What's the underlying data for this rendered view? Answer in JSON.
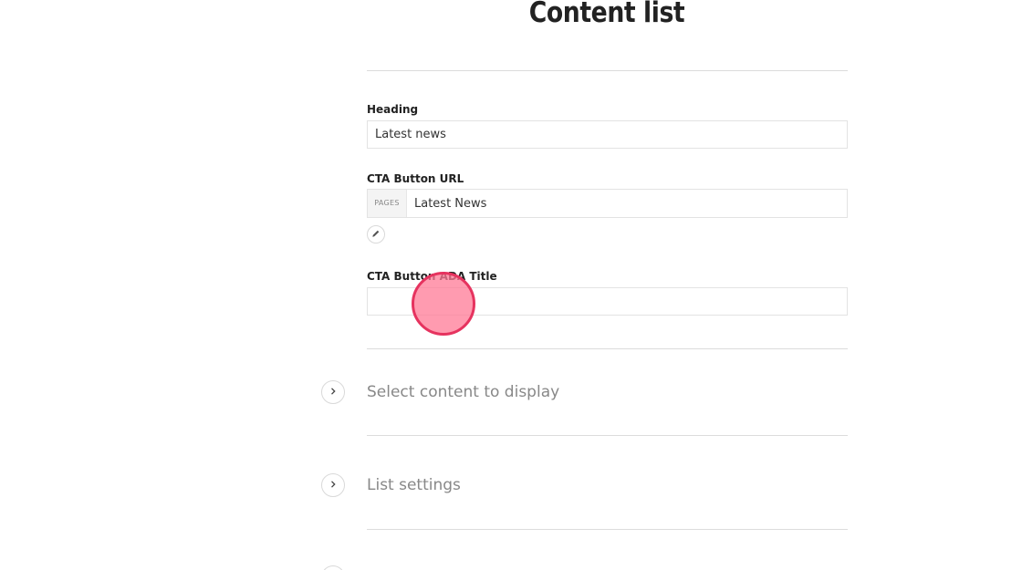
{
  "page_title": "Content list",
  "form": {
    "heading": {
      "label": "Heading",
      "value": "Latest news"
    },
    "cta_url": {
      "label": "CTA Button URL",
      "tag": "PAGES",
      "value": "Latest News",
      "edit_icon": "pencil-icon"
    },
    "cta_ada_title": {
      "label": "CTA Button ADA Title",
      "value": ""
    }
  },
  "sections": [
    {
      "title": "Select content to display",
      "icon": "chevron-right-icon"
    },
    {
      "title": "List settings",
      "icon": "chevron-right-icon"
    }
  ],
  "colors": {
    "click_indicator_fill": "#ff7a96",
    "click_indicator_border": "#e6335f",
    "divider": "#dcdcdc",
    "section_text": "#888888"
  }
}
